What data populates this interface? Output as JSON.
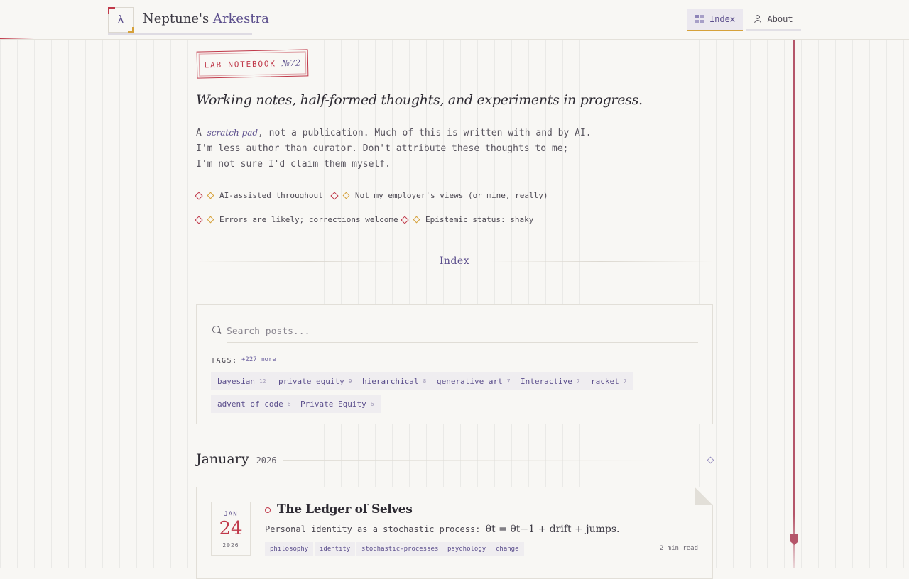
{
  "header": {
    "logo_glyph": "λ",
    "title_primary": "Neptune's",
    "title_accent": "Arkestra",
    "nav": [
      {
        "label": "Index",
        "icon": "grid-icon",
        "active": true
      },
      {
        "label": "About",
        "icon": "person-icon",
        "active": false
      }
    ]
  },
  "stamp": {
    "label": "LAB NOTEBOOK",
    "number": "№72"
  },
  "headline": "Working notes, half-formed thoughts, and experiments in progress.",
  "intro": {
    "prefix": "A ",
    "emphasis": "scratch pad",
    "line1_rest": ", not a publication. Much of this is written with—and by—AI.",
    "line2": "I'm less author than curator. Don't attribute these thoughts to me;",
    "line3": "I'm not sure I'd claim them myself."
  },
  "disclaimers": [
    "AI-assisted throughout",
    "Not my employer's views (or mine, really)",
    "Errors are likely; corrections welcome",
    "Epistemic status: shaky"
  ],
  "index_heading": "Index",
  "search": {
    "placeholder": "Search posts...",
    "value": "",
    "tags_label": "TAGS:",
    "more_label": "+227 more",
    "tags": [
      {
        "name": "bayesian",
        "count": "12"
      },
      {
        "name": "private equity",
        "count": "9"
      },
      {
        "name": "hierarchical",
        "count": "8"
      },
      {
        "name": "generative art",
        "count": "7"
      },
      {
        "name": "Interactive",
        "count": "7"
      },
      {
        "name": "racket",
        "count": "7"
      },
      {
        "name": "advent of code",
        "count": "6"
      },
      {
        "name": "Private Equity",
        "count": "6"
      }
    ]
  },
  "month_group": {
    "month": "January",
    "year": "2026"
  },
  "post": {
    "date_month": "JAN",
    "date_day": "24",
    "date_year": "2026",
    "title": "The Ledger of Selves",
    "excerpt_text": "Personal identity as a stochastic process: ",
    "excerpt_math": "θt = θt−1 + drift + jumps.",
    "tags": [
      "philosophy",
      "identity",
      "stochastic-processes",
      "psychology",
      "change"
    ],
    "read_time": "2 min read"
  },
  "colors": {
    "accent_purple": "#5b4e8c",
    "accent_red": "#c0394a",
    "accent_gold": "#d6a13a",
    "background": "#f8f7f4"
  }
}
